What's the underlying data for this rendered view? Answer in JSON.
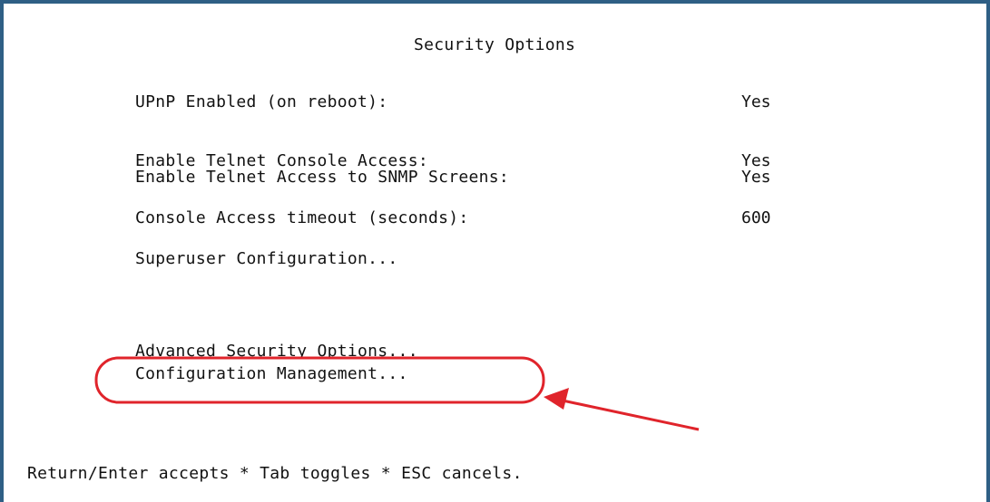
{
  "screen": {
    "title": "Security Options"
  },
  "options": {
    "upnp_label": "UPnP Enabled (on reboot):",
    "upnp_value": "Yes",
    "telnet_console_label": "Enable Telnet Console Access:",
    "telnet_console_value": "Yes",
    "telnet_snmp_label": "Enable Telnet Access to SNMP Screens:",
    "telnet_snmp_value": "Yes",
    "timeout_label": "Console Access timeout (seconds):",
    "timeout_value": "600",
    "superuser_link": "Superuser Configuration...",
    "advanced_link": "Advanced Security Options...",
    "config_mgmt_link": "Configuration Management..."
  },
  "footer": {
    "help_text": "Return/Enter accepts * Tab toggles * ESC cancels."
  },
  "annotation": {
    "highlight_color": "#e0242b"
  }
}
